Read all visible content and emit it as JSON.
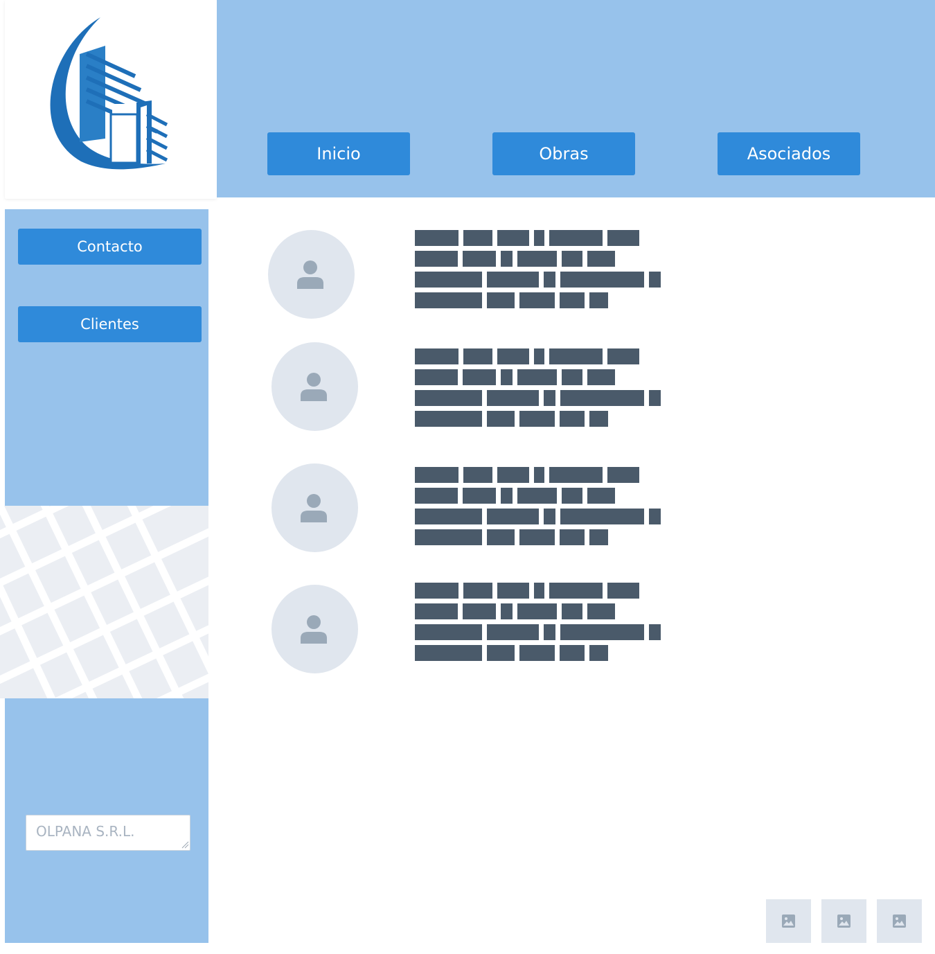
{
  "header": {
    "nav": [
      {
        "label": "Inicio"
      },
      {
        "label": "Obras"
      },
      {
        "label": "Asociados"
      }
    ]
  },
  "sidebar": {
    "buttons": [
      {
        "label": "Contacto"
      },
      {
        "label": "Clientes"
      }
    ],
    "company_field": {
      "placeholder": "OLPANA S.R.L."
    }
  },
  "colors": {
    "accent": "#2f8ada",
    "header_bg": "#97c2eb",
    "text_placeholder_blocks": "#4a5a6a",
    "avatar_bg": "#e0e6ee",
    "avatar_icon": "#9aa9b8"
  },
  "icons": {
    "logo": "building-logo",
    "avatar": "user-icon",
    "thumbnail": "image-icon",
    "map": "map-pattern"
  }
}
